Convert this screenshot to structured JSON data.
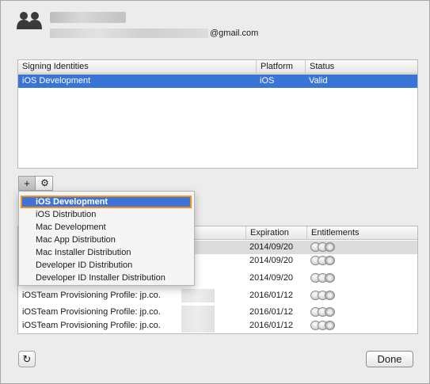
{
  "account": {
    "email_suffix": "@gmail.com"
  },
  "identities_table": {
    "columns": [
      "Signing Identities",
      "Platform",
      "Status"
    ],
    "rows": [
      {
        "identity": "iOS Development",
        "platform": "iOS",
        "status": "Valid",
        "selected": true
      }
    ]
  },
  "toolbar": {
    "add_symbol": "+",
    "gear_symbol": "⚙"
  },
  "add_menu": {
    "items": [
      "iOS Development",
      "iOS Distribution",
      "Mac Development",
      "Mac App Distribution",
      "Mac Installer Distribution",
      "Developer ID Distribution",
      "Developer ID Installer Distribution"
    ],
    "highlighted_index": 0
  },
  "profiles_table": {
    "columns": [
      "Expiration",
      "Entitlements"
    ],
    "rows": [
      {
        "name": "",
        "expiration": "2014/09/20"
      },
      {
        "name": "",
        "expiration": "2014/09/20"
      },
      {
        "name": "",
        "expiration": "2014/09/20"
      },
      {
        "name": "iOSTeam Provisioning Profile: jp.co.",
        "expiration": "2016/01/12"
      },
      {
        "name": "iOSTeam Provisioning Profile: jp.co.",
        "expiration": "2016/01/12"
      },
      {
        "name": "iOSTeam Provisioning Profile: jp.co.",
        "expiration": "2016/01/12"
      }
    ]
  },
  "footer": {
    "refresh_symbol": "↻",
    "done_label": "Done"
  },
  "colors": {
    "selection": "#3875d7",
    "highlight_border": "#f0901e"
  }
}
